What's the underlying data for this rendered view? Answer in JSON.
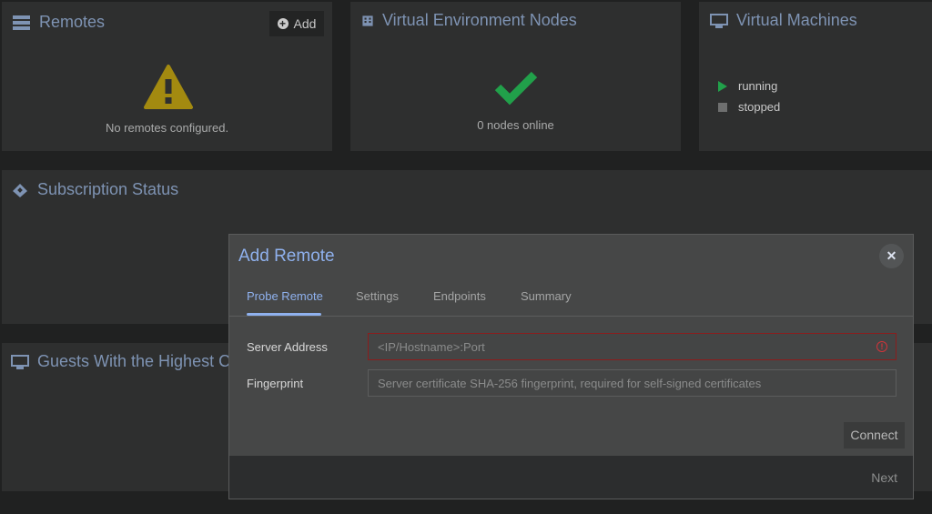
{
  "remotes": {
    "title": "Remotes",
    "add_label": "Add",
    "empty_text": "No remotes configured."
  },
  "nodes": {
    "title": "Virtual Environment Nodes",
    "status": "0 nodes online"
  },
  "vms": {
    "title": "Virtual Machines",
    "legend": [
      {
        "label": "running",
        "color": "#21a04a"
      },
      {
        "label": "stopped",
        "color": "#6e6f6f"
      }
    ]
  },
  "subscription": {
    "title": "Subscription Status"
  },
  "guests": {
    "title": "Guests With the Highest CPU Usage"
  },
  "dialog": {
    "title": "Add Remote",
    "tabs": [
      "Probe Remote",
      "Settings",
      "Endpoints",
      "Summary"
    ],
    "fields": [
      {
        "label": "Server Address",
        "placeholder": "<IP/Hostname>:Port"
      },
      {
        "label": "Fingerprint",
        "placeholder": "Server certificate SHA-256 fingerprint, required for self-signed certificates"
      }
    ],
    "connect_label": "Connect",
    "next_label": "Next"
  }
}
